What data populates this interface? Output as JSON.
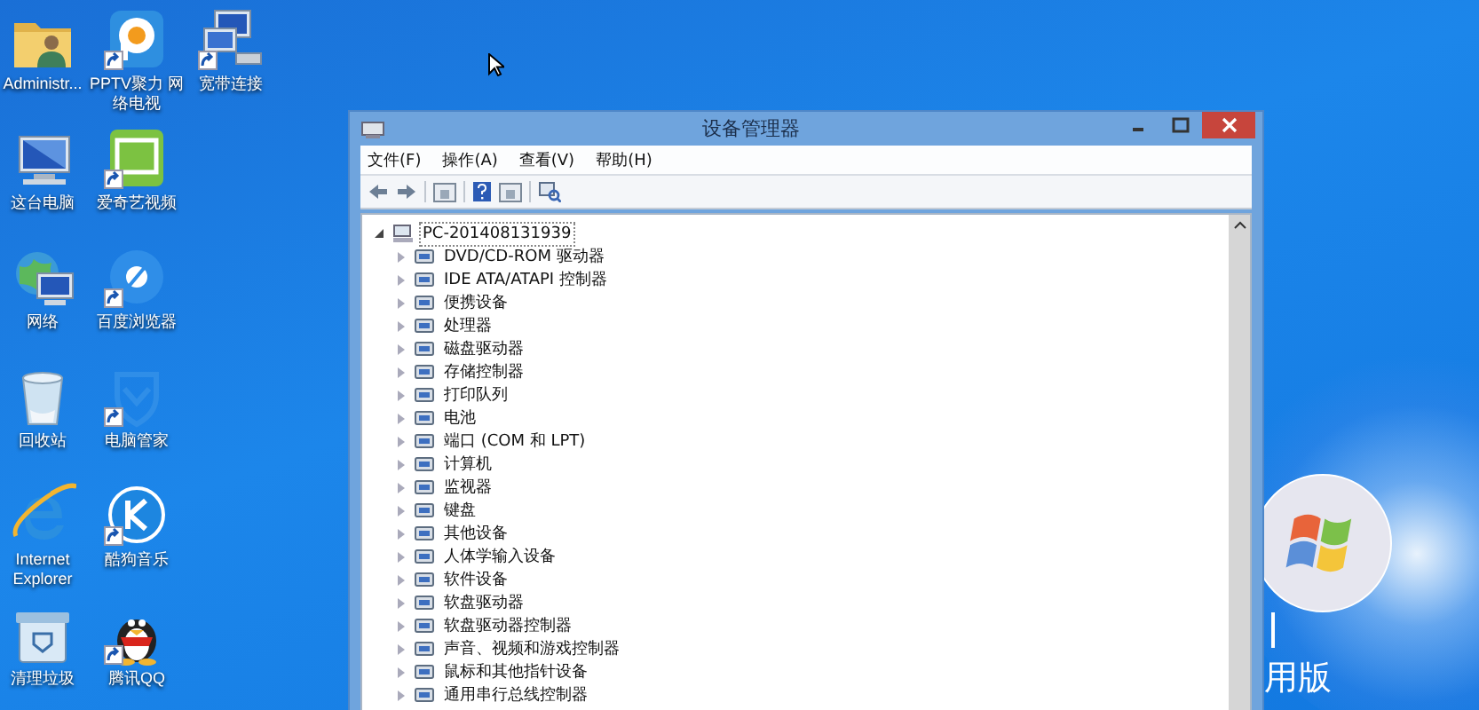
{
  "desktop": {
    "icons": [
      {
        "label": "Administr...",
        "kind": "folder",
        "shortcut": false
      },
      {
        "label": "这台电脑",
        "kind": "pc",
        "shortcut": false
      },
      {
        "label": "网络",
        "kind": "globe",
        "shortcut": false
      },
      {
        "label": "回收站",
        "kind": "recycle",
        "shortcut": false
      },
      {
        "label": "Internet Explorer",
        "kind": "ie",
        "shortcut": false
      },
      {
        "label": "清理垃圾",
        "kind": "cleaner",
        "shortcut": false
      },
      {
        "label": "PPTV聚力 网络电视",
        "kind": "pptv",
        "shortcut": true
      },
      {
        "label": "爱奇艺视频",
        "kind": "iqiyi",
        "shortcut": true
      },
      {
        "label": "百度浏览器",
        "kind": "baidu",
        "shortcut": true
      },
      {
        "label": "电脑管家",
        "kind": "guard",
        "shortcut": true
      },
      {
        "label": "酷狗音乐",
        "kind": "kugou",
        "shortcut": true
      },
      {
        "label": "腾讯QQ",
        "kind": "qq",
        "shortcut": true
      },
      {
        "label": "宽带连接",
        "kind": "network-pc",
        "shortcut": true
      }
    ],
    "wallpaper_text": "用版"
  },
  "window": {
    "title": "设备管理器",
    "menu": [
      "文件(F)",
      "操作(A)",
      "查看(V)",
      "帮助(H)"
    ],
    "tree": {
      "label": "PC-201408131939",
      "expanded": true,
      "selected": true,
      "children": [
        {
          "label": "DVD/CD-ROM 驱动器",
          "expanded": false
        },
        {
          "label": "IDE ATA/ATAPI 控制器",
          "expanded": false
        },
        {
          "label": "便携设备",
          "expanded": false
        },
        {
          "label": "处理器",
          "expanded": false
        },
        {
          "label": "磁盘驱动器",
          "expanded": false
        },
        {
          "label": "存储控制器",
          "expanded": false
        },
        {
          "label": "打印队列",
          "expanded": false
        },
        {
          "label": "电池",
          "expanded": false
        },
        {
          "label": "端口 (COM 和 LPT)",
          "expanded": false
        },
        {
          "label": "计算机",
          "expanded": false
        },
        {
          "label": "监视器",
          "expanded": false
        },
        {
          "label": "键盘",
          "expanded": false
        },
        {
          "label": "其他设备",
          "expanded": false
        },
        {
          "label": "人体学输入设备",
          "expanded": false
        },
        {
          "label": "软件设备",
          "expanded": false
        },
        {
          "label": "软盘驱动器",
          "expanded": false
        },
        {
          "label": "软盘驱动器控制器",
          "expanded": false
        },
        {
          "label": "声音、视频和游戏控制器",
          "expanded": false
        },
        {
          "label": "鼠标和其他指针设备",
          "expanded": false
        },
        {
          "label": "通用串行总线控制器",
          "expanded": false
        }
      ]
    }
  }
}
